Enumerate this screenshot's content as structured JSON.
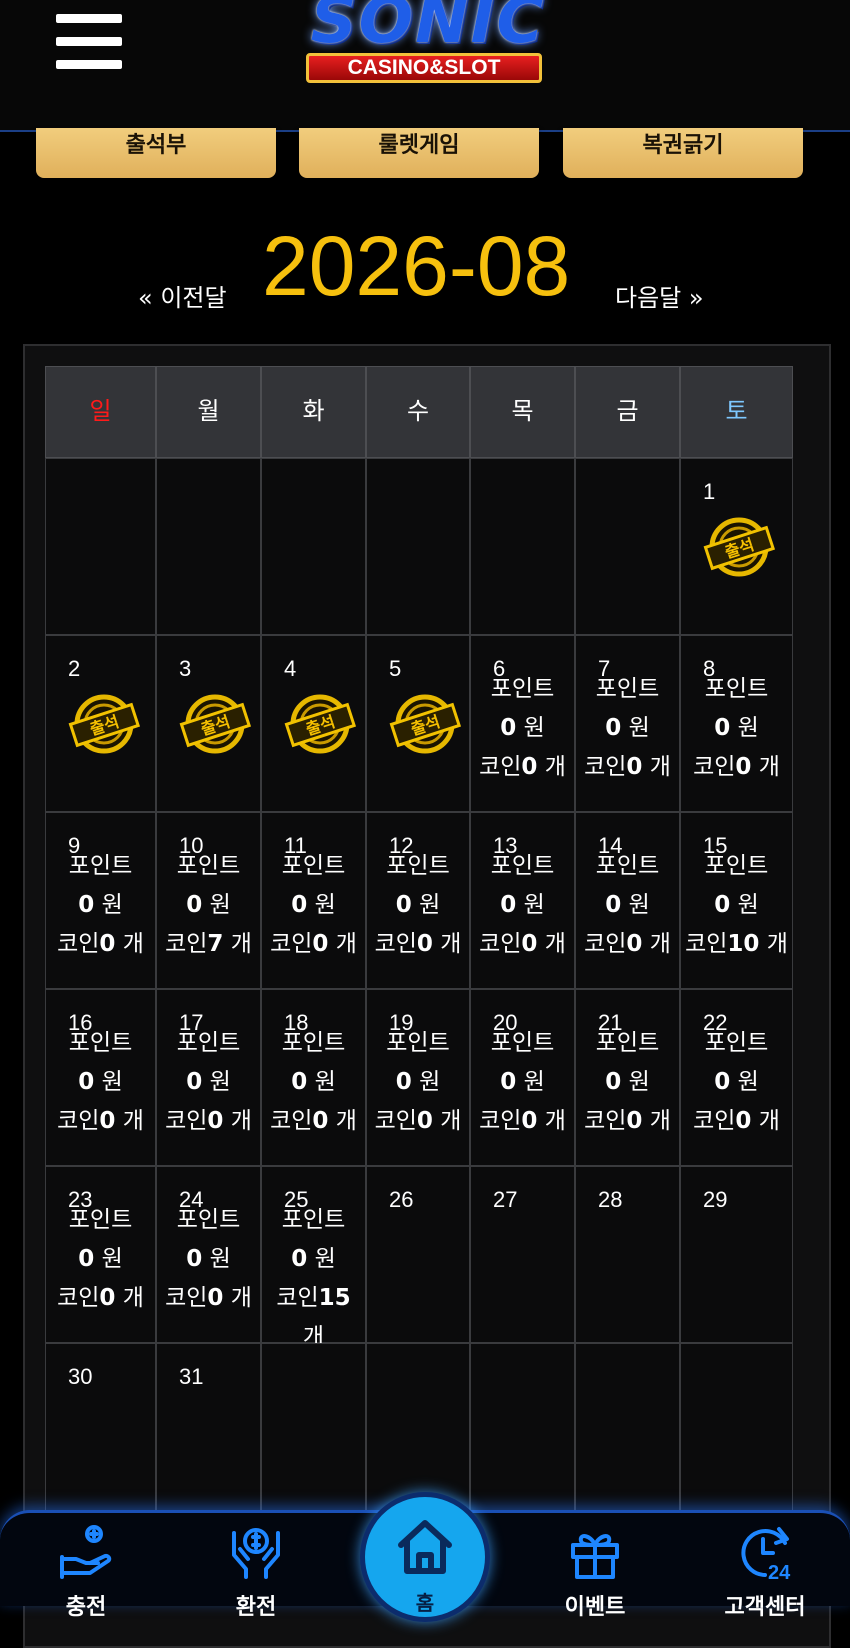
{
  "header": {
    "logo_word": "SONIC",
    "logo_sub": "CASINO&SLOT"
  },
  "tabs": [
    "출석부",
    "룰렛게임",
    "복권긁기"
  ],
  "month_nav": {
    "prev": "« 이전달",
    "title": "2026-08",
    "next": "다음달 »"
  },
  "colors": {
    "accent": "#f6c00e",
    "sunday": "#ff1a1a",
    "saturday": "#7ec8ff",
    "tab_gold": "#e9bd6a",
    "nav_blue": "#15a6ee"
  },
  "calendar": {
    "weekdays": [
      "일",
      "월",
      "화",
      "수",
      "목",
      "금",
      "토"
    ],
    "stamp_label": "출석",
    "point_label": "포인트",
    "won_unit": "원",
    "coin_label": "코인",
    "coin_unit": "개",
    "weeks": [
      [
        null,
        null,
        null,
        null,
        null,
        null,
        {
          "day": "1",
          "stamp": true
        }
      ],
      [
        {
          "day": "2",
          "stamp": true
        },
        {
          "day": "3",
          "stamp": true
        },
        {
          "day": "4",
          "stamp": true
        },
        {
          "day": "5",
          "stamp": true
        },
        {
          "day": "6",
          "point": "0",
          "coin": "0"
        },
        {
          "day": "7",
          "point": "0",
          "coin": "0"
        },
        {
          "day": "8",
          "point": "0",
          "coin": "0"
        }
      ],
      [
        {
          "day": "9",
          "point": "0",
          "coin": "0"
        },
        {
          "day": "10",
          "point": "0",
          "coin": "7"
        },
        {
          "day": "11",
          "point": "0",
          "coin": "0"
        },
        {
          "day": "12",
          "point": "0",
          "coin": "0"
        },
        {
          "day": "13",
          "point": "0",
          "coin": "0"
        },
        {
          "day": "14",
          "point": "0",
          "coin": "0"
        },
        {
          "day": "15",
          "point": "0",
          "coin": "10"
        }
      ],
      [
        {
          "day": "16",
          "point": "0",
          "coin": "0"
        },
        {
          "day": "17",
          "point": "0",
          "coin": "0"
        },
        {
          "day": "18",
          "point": "0",
          "coin": "0"
        },
        {
          "day": "19",
          "point": "0",
          "coin": "0"
        },
        {
          "day": "20",
          "point": "0",
          "coin": "0"
        },
        {
          "day": "21",
          "point": "0",
          "coin": "0"
        },
        {
          "day": "22",
          "point": "0",
          "coin": "0"
        }
      ],
      [
        {
          "day": "23",
          "point": "0",
          "coin": "0"
        },
        {
          "day": "24",
          "point": "0",
          "coin": "0"
        },
        {
          "day": "25",
          "point": "0",
          "coin": "15"
        },
        {
          "day": "26"
        },
        {
          "day": "27"
        },
        {
          "day": "28"
        },
        {
          "day": "29"
        }
      ],
      [
        {
          "day": "30"
        },
        {
          "day": "31"
        },
        null,
        null,
        null,
        null,
        null
      ]
    ]
  },
  "bottom_nav": {
    "items": [
      {
        "label": "충전",
        "icon": "deposit-hand-icon"
      },
      {
        "label": "환전",
        "icon": "withdraw-hands-icon"
      },
      {
        "label": "이벤트",
        "icon": "gift-icon"
      },
      {
        "label": "고객센터",
        "icon": "support-24h-icon"
      }
    ],
    "home_label": "홈",
    "home_icon": "home-icon"
  }
}
